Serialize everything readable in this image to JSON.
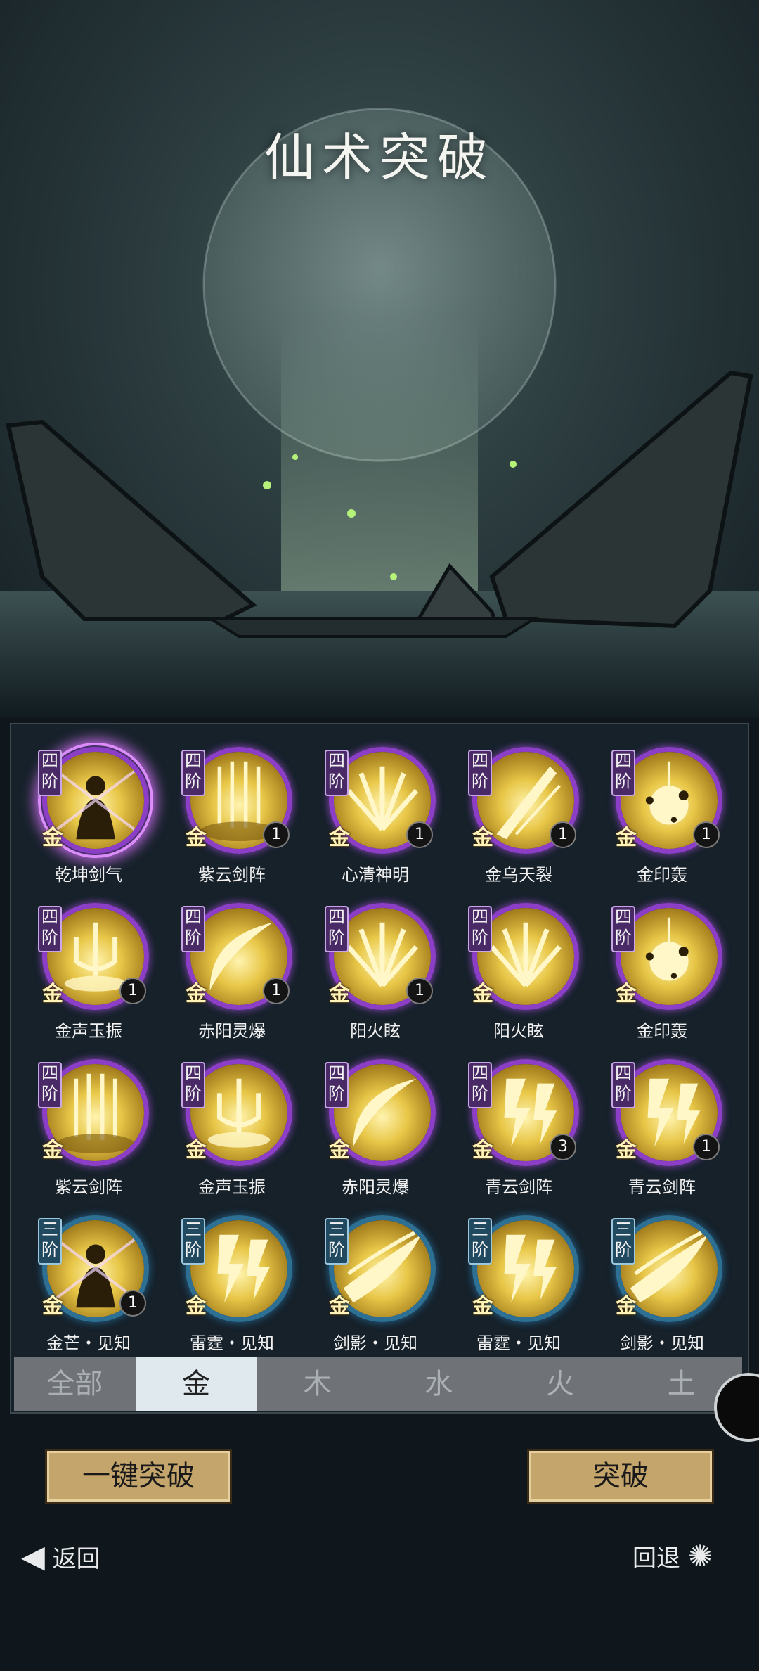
{
  "title": "仙术突破",
  "skills": [
    {
      "name": "乾坤剑气",
      "tier": "四阶",
      "elem": "金",
      "count": "",
      "selected": true,
      "motif": "figure"
    },
    {
      "name": "紫云剑阵",
      "tier": "四阶",
      "elem": "金",
      "count": "1",
      "motif": "swords"
    },
    {
      "name": "心清神明",
      "tier": "四阶",
      "elem": "金",
      "count": "1",
      "motif": "burst"
    },
    {
      "name": "金乌天裂",
      "tier": "四阶",
      "elem": "金",
      "count": "1",
      "motif": "slash"
    },
    {
      "name": "金印轰",
      "tier": "四阶",
      "elem": "金",
      "count": "1",
      "motif": "explode"
    },
    {
      "name": "金声玉振",
      "tier": "四阶",
      "elem": "金",
      "count": "1",
      "motif": "trident"
    },
    {
      "name": "赤阳灵爆",
      "tier": "四阶",
      "elem": "金",
      "count": "1",
      "motif": "crescent"
    },
    {
      "name": "阳火眩",
      "tier": "四阶",
      "elem": "金",
      "count": "1",
      "motif": "burst"
    },
    {
      "name": "阳火眩",
      "tier": "四阶",
      "elem": "金",
      "count": "",
      "motif": "burst"
    },
    {
      "name": "金印轰",
      "tier": "四阶",
      "elem": "金",
      "count": "",
      "motif": "explode"
    },
    {
      "name": "紫云剑阵",
      "tier": "四阶",
      "elem": "金",
      "count": "",
      "motif": "swords"
    },
    {
      "name": "金声玉振",
      "tier": "四阶",
      "elem": "金",
      "count": "",
      "motif": "trident"
    },
    {
      "name": "赤阳灵爆",
      "tier": "四阶",
      "elem": "金",
      "count": "",
      "motif": "crescent"
    },
    {
      "name": "青云剑阵",
      "tier": "四阶",
      "elem": "金",
      "count": "3",
      "motif": "bolt"
    },
    {
      "name": "青云剑阵",
      "tier": "四阶",
      "elem": "金",
      "count": "1",
      "motif": "bolt"
    },
    {
      "name": "金芒・见知",
      "tier": "三阶",
      "elem": "金",
      "count": "1",
      "motif": "figure"
    },
    {
      "name": "雷霆・见知",
      "tier": "三阶",
      "elem": "金",
      "count": "",
      "motif": "bolt"
    },
    {
      "name": "剑影・见知",
      "tier": "三阶",
      "elem": "金",
      "count": "",
      "motif": "wave"
    },
    {
      "name": "雷霆・见知",
      "tier": "三阶",
      "elem": "金",
      "count": "",
      "motif": "bolt"
    },
    {
      "name": "剑影・见知",
      "tier": "三阶",
      "elem": "金",
      "count": "",
      "motif": "wave"
    }
  ],
  "tabs": [
    "全部",
    "金",
    "木",
    "水",
    "火",
    "土"
  ],
  "active_tab": "金",
  "buttons": {
    "auto_break": "一键突破",
    "break": "突破"
  },
  "nav": {
    "back": "返回",
    "undo": "回退"
  }
}
